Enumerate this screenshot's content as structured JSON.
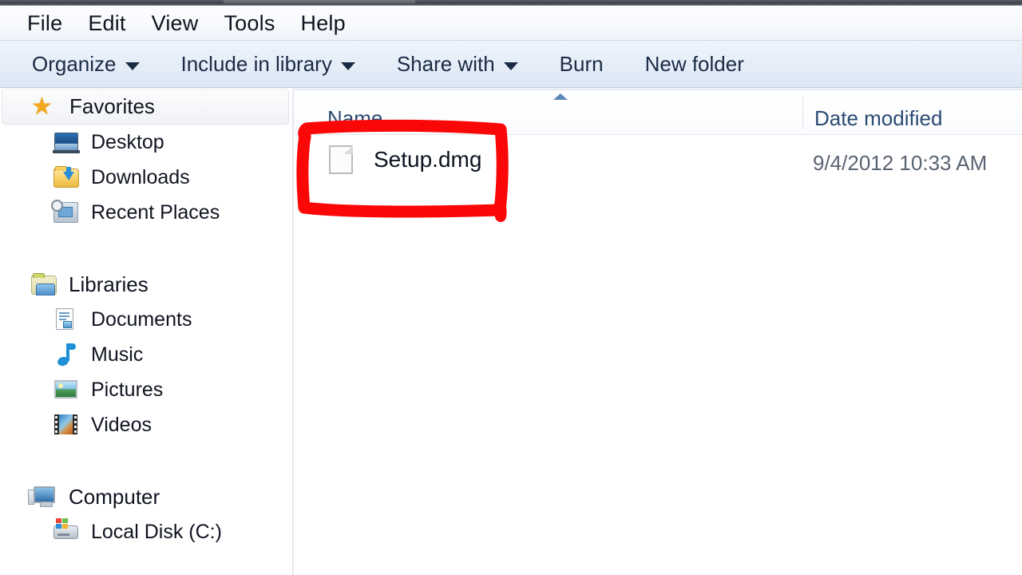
{
  "window": {
    "menubar": {
      "items": [
        {
          "label": "File",
          "name": "menu-file"
        },
        {
          "label": "Edit",
          "name": "menu-edit"
        },
        {
          "label": "View",
          "name": "menu-view"
        },
        {
          "label": "Tools",
          "name": "menu-tools"
        },
        {
          "label": "Help",
          "name": "menu-help"
        }
      ]
    },
    "toolbar": {
      "organize": "Organize",
      "include_in_library": "Include in library",
      "share_with": "Share with",
      "burn": "Burn",
      "new_folder": "New folder"
    }
  },
  "sidebar": {
    "favorites": {
      "label": "Favorites",
      "icon": "star-icon",
      "selected": true,
      "items": [
        {
          "label": "Desktop",
          "icon": "desktop-icon"
        },
        {
          "label": "Downloads",
          "icon": "downloads-folder-icon"
        },
        {
          "label": "Recent Places",
          "icon": "recent-places-icon"
        }
      ]
    },
    "libraries": {
      "label": "Libraries",
      "icon": "libraries-icon",
      "items": [
        {
          "label": "Documents",
          "icon": "documents-icon"
        },
        {
          "label": "Music",
          "icon": "music-note-icon"
        },
        {
          "label": "Pictures",
          "icon": "pictures-icon"
        },
        {
          "label": "Videos",
          "icon": "videos-filmstrip-icon"
        }
      ]
    },
    "computer": {
      "label": "Computer",
      "icon": "computer-icon",
      "items": [
        {
          "label": "Local Disk (C:)",
          "icon": "hard-disk-icon"
        }
      ]
    }
  },
  "file_list": {
    "columns": [
      {
        "label": "Name",
        "sorted": "ascending"
      },
      {
        "label": "Date modified",
        "sorted": "none"
      }
    ],
    "rows": [
      {
        "name": "Setup.dmg",
        "date_modified": "9/4/2012 10:33 AM",
        "icon": "generic-file-icon"
      }
    ]
  },
  "annotation": {
    "type": "hand-drawn-rectangle",
    "color": "#fb0707",
    "target": "Setup.dmg"
  },
  "colors": {
    "accent_header_text": "#2c4a72",
    "toolbar_bg": "#e6eef8",
    "annotation_red": "#fb0707"
  }
}
